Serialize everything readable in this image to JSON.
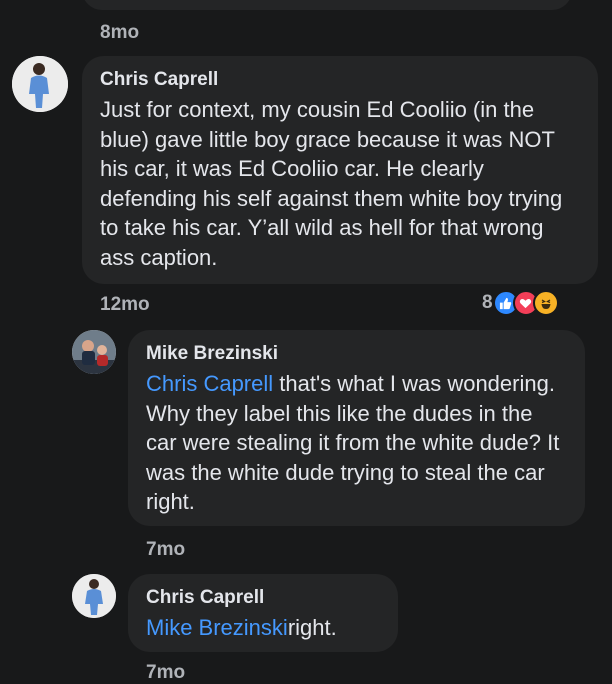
{
  "top_comment": {
    "timestamp": "8mo"
  },
  "comments": [
    {
      "author": "Chris Caprell",
      "text": "Just for context, my cousin Ed Cooliio  (in the blue) gave little boy grace because it was NOT his car, it was Ed Cooliio car. He clearly defending his self against them white boy trying to take his car. Y’all wild as hell for that wrong ass caption.",
      "timestamp": "12mo",
      "reaction_count": "8",
      "reactions": [
        "like-icon",
        "love-icon",
        "haha-icon"
      ]
    },
    {
      "author": "Mike Brezinski",
      "mention": "Chris Caprell",
      "text": " that's what I was wondering. Why they label this like the dudes in the car were stealing it from the white dude? It was the white dude trying to steal the car right.",
      "timestamp": "7mo"
    },
    {
      "author": "Chris Caprell",
      "mention": "Mike Brezinski",
      "text": "right.",
      "timestamp": "7mo"
    }
  ],
  "colors": {
    "background": "#18191a",
    "bubble": "#242526",
    "mention": "#4599ff",
    "like": "#2d88ff",
    "love": "#f33e58",
    "haha": "#f7b125"
  }
}
